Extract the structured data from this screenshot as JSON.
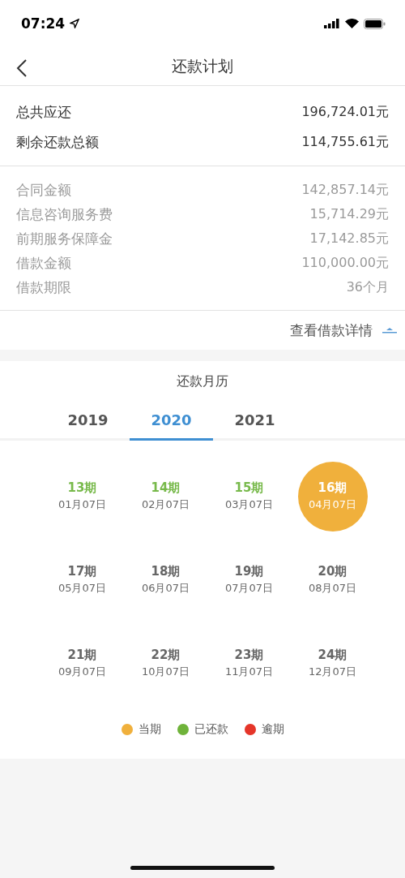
{
  "status_bar": {
    "time": "07:24"
  },
  "header": {
    "title": "还款计划"
  },
  "summary": [
    {
      "label": "总共应还",
      "value": "196,724.01元"
    },
    {
      "label": "剩余还款总额",
      "value": "114,755.61元"
    }
  ],
  "details": [
    {
      "label": "合同金额",
      "value": "142,857.14元"
    },
    {
      "label": "信息咨询服务费",
      "value": "15,714.29元"
    },
    {
      "label": "前期服务保障金",
      "value": "17,142.85元"
    },
    {
      "label": "借款金额",
      "value": "110,000.00元"
    },
    {
      "label": "借款期限",
      "value": "36个月"
    }
  ],
  "details_link": {
    "label": "查看借款详情",
    "expanded": true
  },
  "calendar": {
    "title": "还款月历",
    "tabs": [
      {
        "label": "2019",
        "selected": false
      },
      {
        "label": "2020",
        "selected": true
      },
      {
        "label": "2021",
        "selected": false
      }
    ],
    "periods": [
      {
        "period": "13期",
        "date": "01月07日",
        "kind": "paid"
      },
      {
        "period": "14期",
        "date": "02月07日",
        "kind": "paid"
      },
      {
        "period": "15期",
        "date": "03月07日",
        "kind": "paid"
      },
      {
        "period": "16期",
        "date": "04月07日",
        "kind": "current"
      },
      {
        "period": "17期",
        "date": "05月07日",
        "kind": "upcoming"
      },
      {
        "period": "18期",
        "date": "06月07日",
        "kind": "upcoming"
      },
      {
        "period": "19期",
        "date": "07月07日",
        "kind": "upcoming"
      },
      {
        "period": "20期",
        "date": "08月07日",
        "kind": "upcoming"
      },
      {
        "period": "21期",
        "date": "09月07日",
        "kind": "upcoming"
      },
      {
        "period": "22期",
        "date": "10月07日",
        "kind": "upcoming"
      },
      {
        "period": "23期",
        "date": "11月07日",
        "kind": "upcoming"
      },
      {
        "period": "24期",
        "date": "12月07日",
        "kind": "upcoming"
      }
    ],
    "legend": [
      {
        "label": "当期",
        "color": "#f0b03c"
      },
      {
        "label": "已还款",
        "color": "#6fb33a"
      },
      {
        "label": "逾期",
        "color": "#e53529"
      }
    ]
  }
}
